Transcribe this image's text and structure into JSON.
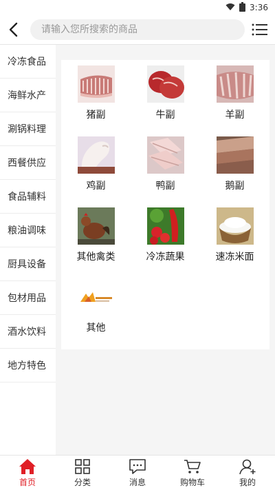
{
  "status_bar": {
    "time": "3:36",
    "icons": [
      "wifi-icon",
      "battery-icon"
    ]
  },
  "header": {
    "search_placeholder": "请输入您所搜索的商品",
    "back_icon": "chevron-left-icon",
    "menu_icon": "list-menu-icon"
  },
  "sidebar": {
    "items": [
      {
        "label": "冷冻食品"
      },
      {
        "label": "海鲜水产"
      },
      {
        "label": "涮锅料理"
      },
      {
        "label": "西餐供应"
      },
      {
        "label": "食品辅料"
      },
      {
        "label": "粮油调味"
      },
      {
        "label": "厨具设备"
      },
      {
        "label": "包材用品"
      },
      {
        "label": "酒水饮料"
      },
      {
        "label": "地方特色"
      }
    ]
  },
  "categories": [
    {
      "label": "猪副",
      "icon": "pork-ribs-image"
    },
    {
      "label": "牛副",
      "icon": "beef-image"
    },
    {
      "label": "羊副",
      "icon": "lamb-ribs-image"
    },
    {
      "label": "鸡副",
      "icon": "chicken-leg-image"
    },
    {
      "label": "鸭副",
      "icon": "duck-image"
    },
    {
      "label": "鹅副",
      "icon": "goose-image"
    },
    {
      "label": "其他禽类",
      "icon": "poultry-image"
    },
    {
      "label": "冷冻蔬果",
      "icon": "vegetables-image"
    },
    {
      "label": "速冻米面",
      "icon": "rice-image"
    },
    {
      "label": "其他",
      "icon": "logo-image"
    }
  ],
  "tabbar": {
    "active": "首页",
    "items": [
      {
        "label": "首页",
        "icon": "home-icon"
      },
      {
        "label": "分类",
        "icon": "grid-icon"
      },
      {
        "label": "消息",
        "icon": "message-icon"
      },
      {
        "label": "购物车",
        "icon": "cart-icon"
      },
      {
        "label": "我的",
        "icon": "user-icon"
      }
    ]
  },
  "colors": {
    "accent": "#e01f26"
  }
}
